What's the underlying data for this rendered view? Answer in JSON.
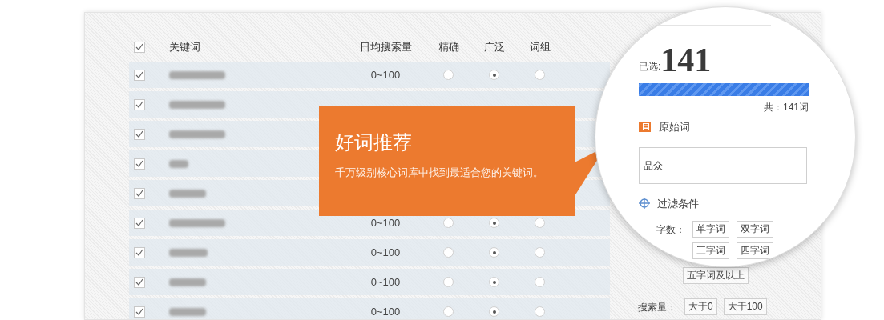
{
  "header": {
    "select_all_checked": true,
    "columns": [
      "关键词",
      "日均搜索量",
      "精确",
      "广泛",
      "词组"
    ]
  },
  "rows": [
    {
      "checked": true,
      "volume": "0~100",
      "radios": [
        {
          "selected": false
        },
        {
          "selected": true
        },
        {
          "selected": false
        }
      ]
    },
    {
      "checked": true
    },
    {
      "checked": true
    },
    {
      "checked": true
    },
    {
      "checked": true
    },
    {
      "checked": true,
      "volume": "0~100",
      "radios": [
        {
          "selected": false
        },
        {
          "selected": true
        },
        {
          "selected": false
        }
      ]
    },
    {
      "checked": true,
      "volume": "0~100",
      "radios": [
        {
          "selected": false
        },
        {
          "selected": true
        },
        {
          "selected": false
        }
      ]
    },
    {
      "checked": true,
      "volume": "0~100",
      "radios": [
        {
          "selected": false
        },
        {
          "selected": true
        },
        {
          "selected": false
        }
      ]
    },
    {
      "checked": true,
      "volume": "0~100",
      "radios": [
        {
          "selected": false
        },
        {
          "selected": true
        },
        {
          "selected": false
        }
      ]
    }
  ],
  "callout": {
    "title": "好词推荐",
    "text": "千万级别核心词库中找到最适合您的关键词。"
  },
  "magnifier": {
    "selected_label": "已选:",
    "selected_count": "141",
    "progress": {
      "level": 1
    },
    "total": "共：141词",
    "source_title": "原始词",
    "source_value": "品众",
    "filter_title": "过滤条件",
    "word_count_label": "字数：",
    "word_count_options": [
      "单字词",
      "双字词",
      "三字词",
      "四字词"
    ]
  },
  "side_panel": {
    "word_count_more": "五字词及以上",
    "volume_label": "搜索量：",
    "volume_options": [
      "大于0",
      "大于100"
    ]
  }
}
